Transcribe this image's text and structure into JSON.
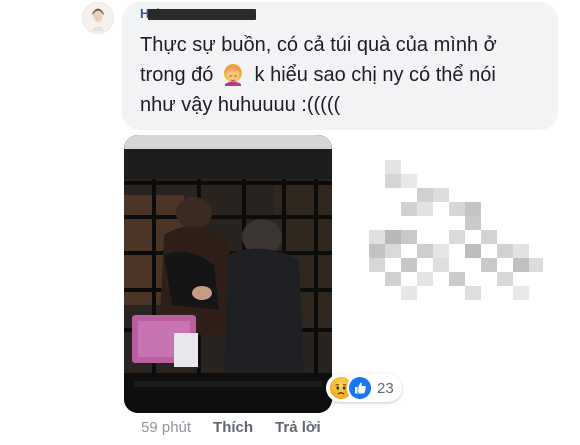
{
  "comment": {
    "author": "H                 ớ",
    "text_line1": "Thực sự buồn, có cả túi quà của mình ở",
    "text_line2_before": "trong đó",
    "text_line2_after": "k hiểu sao chị ny có thể nói",
    "text_line3": "như vậy huhuuuu :(((((",
    "emoji": "woman-facepalming-emoji"
  },
  "reactions": {
    "icons": [
      "sad-reaction",
      "like-reaction"
    ],
    "count": "23",
    "sad_color": "#f7b125",
    "like_color": "#1877f2"
  },
  "footer": {
    "time": "59 phút",
    "like_label": "Thích",
    "reply_label": "Trả lời"
  }
}
